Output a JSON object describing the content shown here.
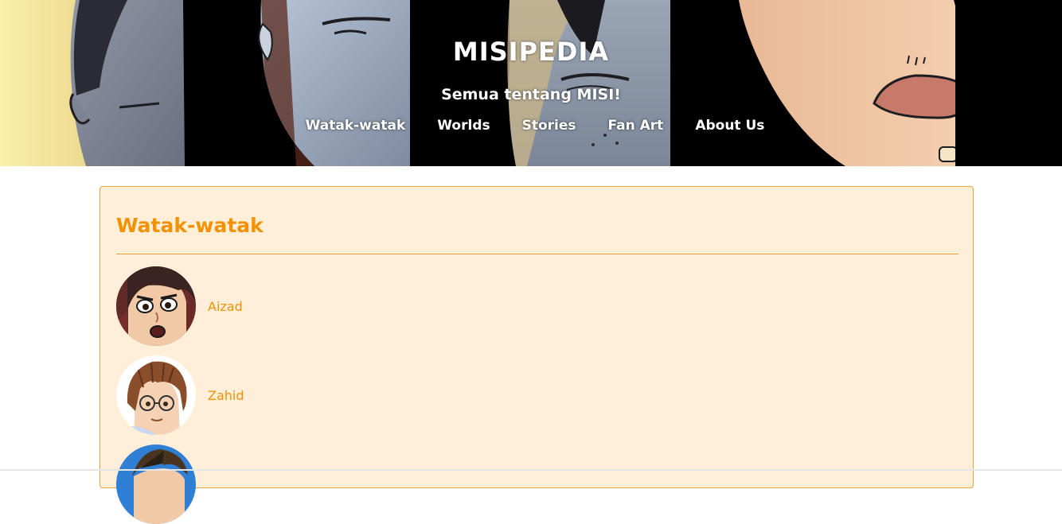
{
  "header": {
    "title": "MISIPEDIA",
    "tagline": "Semua tentang MISI!"
  },
  "nav": {
    "items": [
      {
        "label": "Watak-watak"
      },
      {
        "label": "Worlds"
      },
      {
        "label": "Stories"
      },
      {
        "label": "Fan Art"
      },
      {
        "label": "About Us"
      }
    ]
  },
  "main": {
    "heading": "Watak-watak",
    "characters": [
      {
        "name": "Aizad"
      },
      {
        "name": "Zahid"
      },
      {
        "name": ""
      }
    ]
  },
  "colors": {
    "accent": "#f39200",
    "card_background": "#ffefd9",
    "card_border": "#e8a33a",
    "header_text": "#ffffff"
  }
}
